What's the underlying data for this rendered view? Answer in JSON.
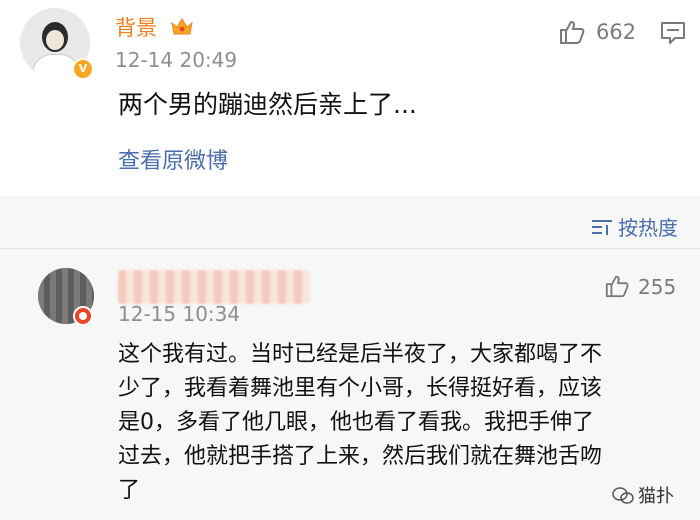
{
  "post": {
    "author": "背景",
    "time": "12-14 20:49",
    "likes": "662",
    "text": "两个男的蹦迪然后亲上了...",
    "view_original": "查看原微博",
    "verified_icon": "v-badge-icon",
    "member_icon": "crown-icon"
  },
  "sort": {
    "label": "按热度",
    "icon": "sort-icon"
  },
  "comment": {
    "author": "",
    "time": "12-15 10:34",
    "likes": "255",
    "lines": [
      "这个我有过。当时已经是后半夜了，大家都喝了不",
      "少了，我看着舞池里有个小哥，长得挺好看，应该",
      "是0，多看了他几眼，他也看了看我。我把手伸了",
      "过去，他就把手搭了上来，然后我们就在舞池舌吻",
      "了"
    ]
  },
  "watermark": {
    "text": "猫扑",
    "icon": "wechat-icon"
  },
  "colors": {
    "author": "#f07e1a",
    "link": "#4a6ea9",
    "meta": "#8e8e8e"
  }
}
